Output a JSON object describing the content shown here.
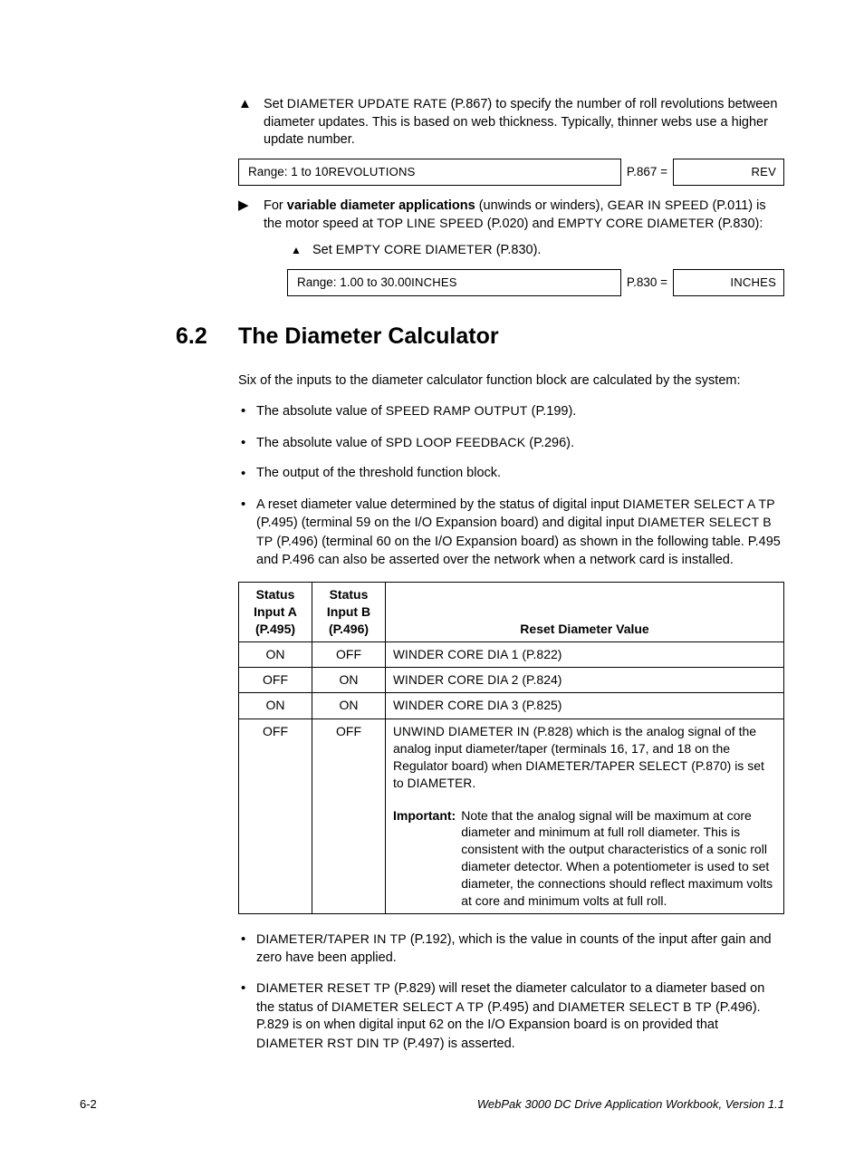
{
  "step1": {
    "text_pre": "Set ",
    "sc1": "DIAMETER UPDATE RATE",
    "text_mid": " (P.867) to specify the number of roll revolutions between diameter updates. This is based on web thickness. Typically, thinner webs use a higher update number.",
    "range_pre": "Range: 1 to 10 ",
    "range_sc": "REVOLUTIONS",
    "param_label": "P.867 =",
    "param_unit": "REV"
  },
  "step2": {
    "text_pre": "For ",
    "bold": "variable diameter applications",
    "text_mid1": " (unwinds or winders), ",
    "sc1": "GEAR IN SPEED",
    "text_mid2": " (P.011) is the motor speed at ",
    "sc2": "TOP LINE SPEED",
    "text_mid3": " (P.020) and ",
    "sc3": "EMPTY CORE DIAMETER",
    "text_mid4": " (P.830):",
    "sub_pre": "Set ",
    "sub_sc": "EMPTY CORE DIAMETER",
    "sub_post": " (P.830).",
    "range_pre": "Range: 1.00 to 30.00 ",
    "range_sc": "INCHES",
    "param_label": "P.830 =",
    "param_unit": "INCHES"
  },
  "heading": {
    "num": "6.2",
    "text": "The Diameter Calculator"
  },
  "intro": "Six of the inputs to the diameter calculator function block are calculated by the system:",
  "b1": {
    "pre": "The absolute value of ",
    "sc": "SPEED RAMP OUTPUT",
    "post": " (P.199)."
  },
  "b2": {
    "pre": "The absolute value of ",
    "sc": "SPD LOOP FEEDBACK",
    "post": " (P.296)."
  },
  "b3": {
    "text": "The output of the threshold function block."
  },
  "b4": {
    "pre": "A reset diameter value determined by the status of digital input ",
    "sc1": "DIAMETER SELECT A TP",
    "mid1": " (P.495) (terminal 59 on the I/O Expansion board) and digital input ",
    "sc2": "DIAMETER SELECT B TP",
    "mid2": " (P.496) (terminal 60 on the I/O Expansion board) as shown in the following table. P.495 and P.496 can also be asserted over the network when a network card is installed."
  },
  "table": {
    "headA": "Status Input A (P.495)",
    "headB": "Status Input B (P.496)",
    "headC": "Reset Diameter Value",
    "rows": [
      {
        "a": "ON",
        "b": "OFF",
        "sc": "WINDER CORE DIA 1",
        "post": " (P.822)"
      },
      {
        "a": "OFF",
        "b": "ON",
        "sc": "WINDER CORE DIA 2",
        "post": " (P.824)"
      },
      {
        "a": "ON",
        "b": "ON",
        "sc": "WINDER CORE DIA 3",
        "post": " (P.825)"
      }
    ],
    "row4": {
      "a": "OFF",
      "b": "OFF",
      "sc1": "UNWIND DIAMETER IN",
      "t1": " (P.828) which is the analog signal of the analog input diameter/taper (terminals 16, 17, and 18 on the Regulator board) when ",
      "sc2": "DIAMETER/TAPER SELECT",
      "t2": " (P.870) is set to ",
      "sc3": "DIAMETER",
      "t3": ".",
      "imp_label": "Important:",
      "imp_text": "Note that the analog signal will be maximum at core diameter and minimum at full roll diameter. This is consistent with the output characteristics of a sonic roll diameter detector. When a potentiometer is used to set diameter, the connections should reflect maximum volts at core and minimum volts at full roll."
    }
  },
  "b5": {
    "sc1": "DIAMETER/TAPER IN TP",
    "t1": " (P.192), which is the value in counts of the input after gain and zero have been applied."
  },
  "b6": {
    "sc1": "DIAMETER RESET TP",
    "t1": " (P.829) will reset the diameter calculator to a diameter based on the status of ",
    "sc2": "DIAMETER SELECT A TP",
    "t2": " (P.495) and ",
    "sc3": "DIAMETER SELECT B TP",
    "t3": " (P.496). P.829 is on when digital input 62 on the I/O Expansion board is on provided that ",
    "sc4": "DIAMETER RST DIN TP",
    "t4": " (P.497) is asserted."
  },
  "footer": {
    "left": "6-2",
    "right": "WebPak 3000 DC Drive Application Workbook, Version 1.1"
  }
}
